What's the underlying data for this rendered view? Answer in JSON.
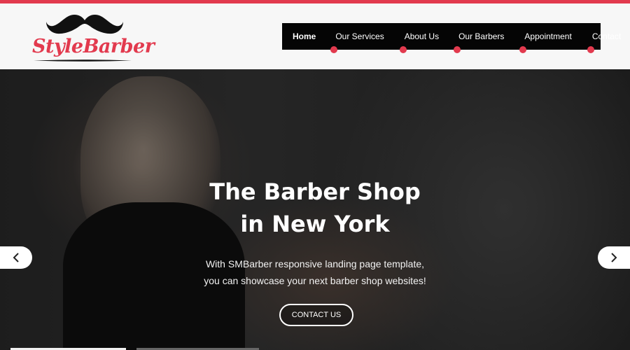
{
  "brand": {
    "name": "StyleBarber",
    "accent_color": "#e23a4e",
    "icon": "mustache-icon"
  },
  "nav": {
    "items": [
      {
        "label": "Home",
        "active": true
      },
      {
        "label": "Our Services",
        "active": false
      },
      {
        "label": "About Us",
        "active": false
      },
      {
        "label": "Our Barbers",
        "active": false
      },
      {
        "label": "Appointment",
        "active": false
      },
      {
        "label": "Contact",
        "active": false
      }
    ]
  },
  "hero": {
    "title": "The Barber Shop",
    "subtitle": "in New York",
    "description_line1": "With SMBarber responsive landing page template,",
    "description_line2": "you can showcase your next barber shop websites!",
    "cta_label": "CONTACT US",
    "prev_icon": "chevron-left-icon",
    "next_icon": "chevron-right-icon"
  }
}
